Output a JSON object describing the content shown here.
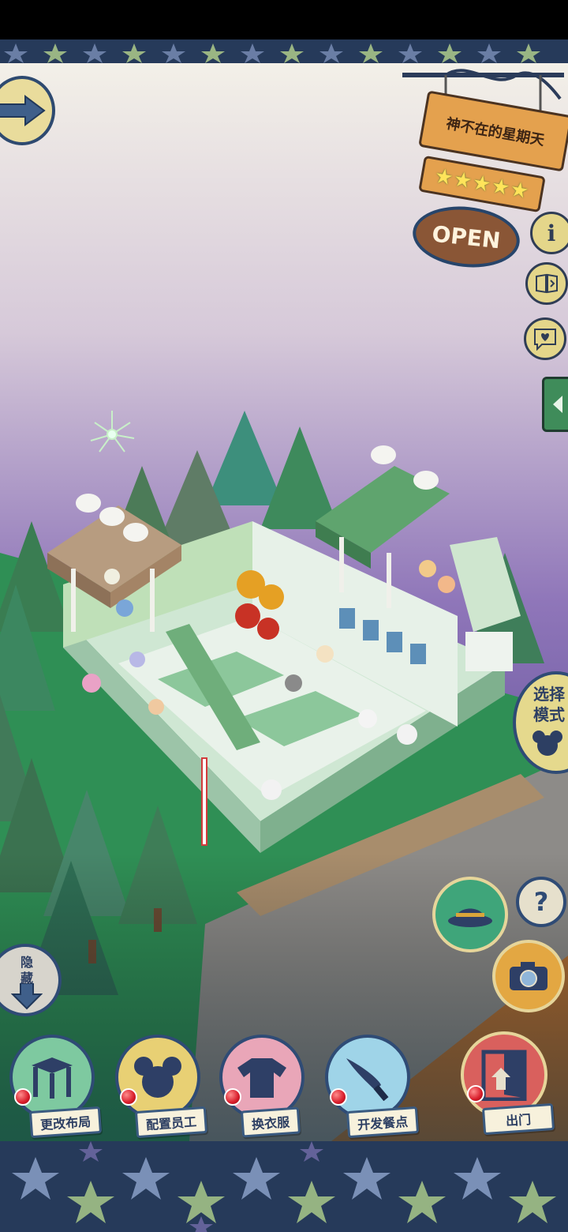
{
  "cafe_sign": {
    "name": "神不在的星期天",
    "stars": "★★★★★",
    "open_label": "OPEN"
  },
  "side_buttons": {
    "info_label": "i",
    "select_mode_label": "选择\n模式"
  },
  "help_label": "?",
  "hide_button": {
    "label": "隐\n藏"
  },
  "bottom_menu": [
    {
      "label": "更改布局",
      "icon": "table-icon",
      "bg": "#7ec9a0"
    },
    {
      "label": "配置员工",
      "icon": "mouse-staff-icon",
      "bg": "#e8d074"
    },
    {
      "label": "换衣服",
      "icon": "shirt-icon",
      "bg": "#e9a6b8"
    },
    {
      "label": "开发餐点",
      "icon": "knife-icon",
      "bg": "#9fd4e8"
    },
    {
      "label": "出门",
      "icon": "door-icon",
      "bg": "#d9605d"
    }
  ],
  "colors": {
    "sky_top": "#f1eee6",
    "sky_bottom": "#8a74b8",
    "grass": "#2f9a57",
    "road": "#8d8b88",
    "dirt": "#b36e32",
    "navy": "#263a5a"
  }
}
